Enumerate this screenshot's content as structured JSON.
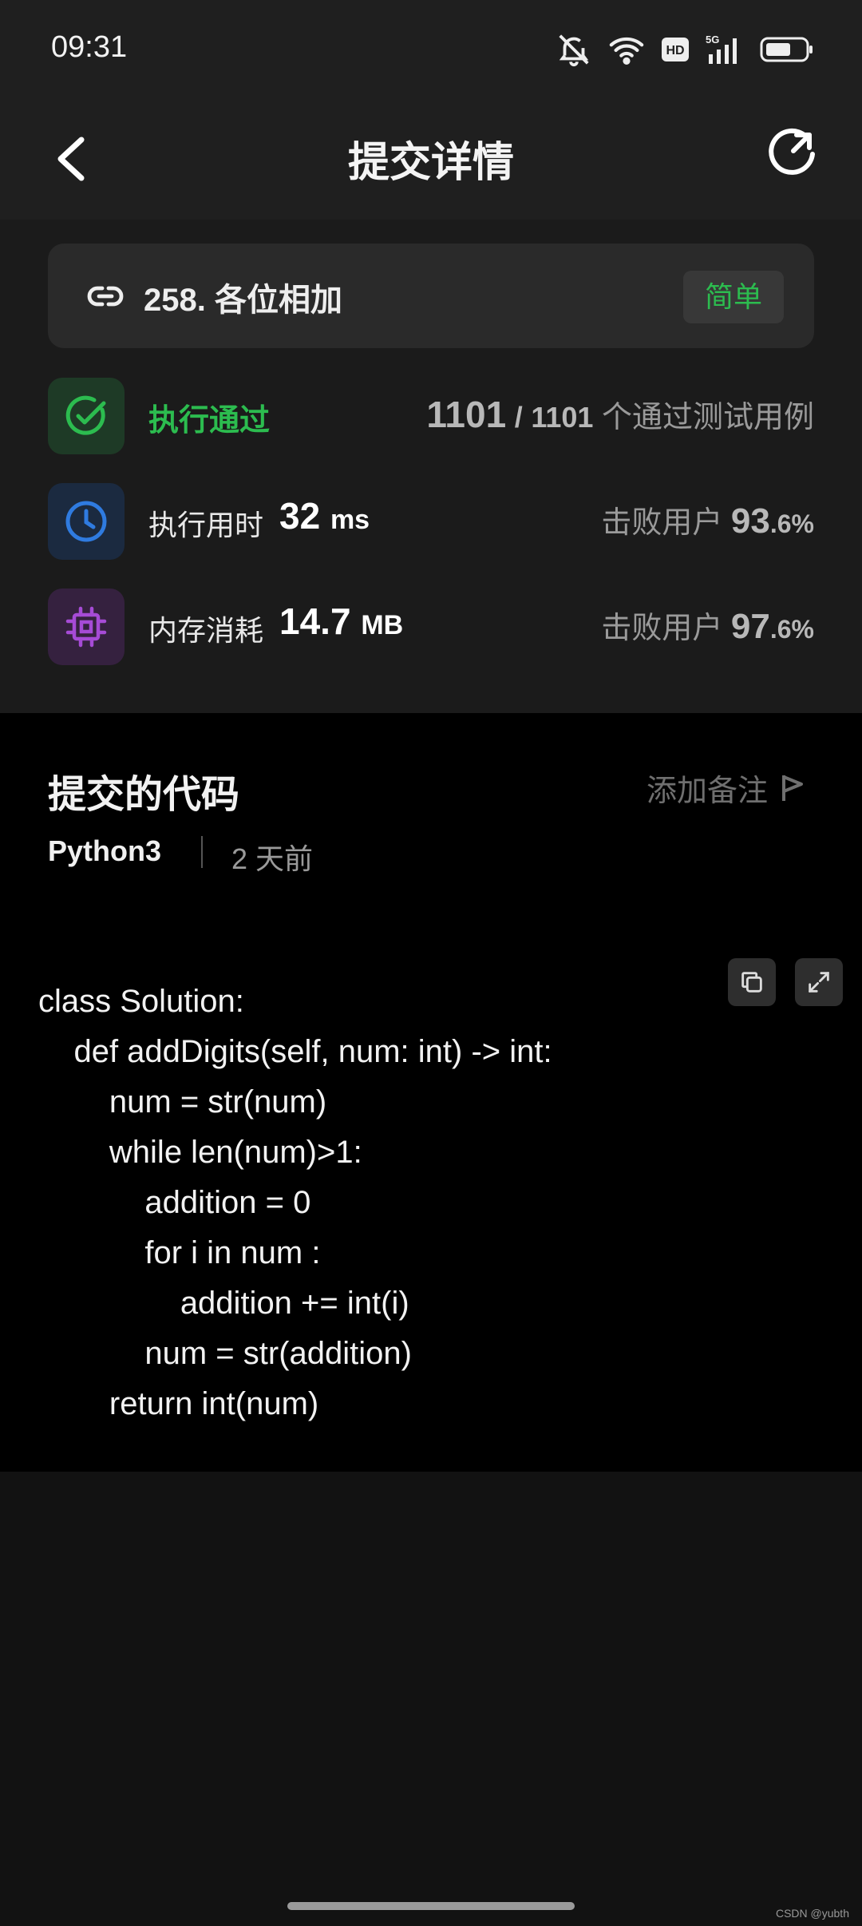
{
  "status_bar": {
    "time": "09:31",
    "hd": "HD",
    "network": "5G"
  },
  "header": {
    "title": "提交详情"
  },
  "problem": {
    "title": "258. 各位相加",
    "difficulty": "简单"
  },
  "result": {
    "status": "执行通过",
    "passed": "1101",
    "separator": "/",
    "total": "1101",
    "suffix": "个通过测试用例"
  },
  "runtime": {
    "label": "执行用时",
    "value": "32",
    "unit": "ms",
    "beat_label": "击败用户",
    "beat_int": "93",
    "beat_dec": ".6%"
  },
  "memory": {
    "label": "内存消耗",
    "value": "14.7",
    "unit": "MB",
    "beat_label": "击败用户",
    "beat_int": "97",
    "beat_dec": ".6%"
  },
  "code_section": {
    "title": "提交的代码",
    "add_note": "添加备注",
    "language": "Python3",
    "time_ago": "2 天前",
    "code": "class Solution:\n    def addDigits(self, num: int) -> int:\n        num = str(num)\n        while len(num)>1:\n            addition = 0\n            for i in num :\n                addition += int(i)\n            num = str(addition)\n        return int(num)"
  },
  "watermark": "CSDN @yubth",
  "colors": {
    "accent_green": "#2cbc4f",
    "clock_blue": "#2f7be0",
    "chip_purple": "#a64bd6"
  }
}
